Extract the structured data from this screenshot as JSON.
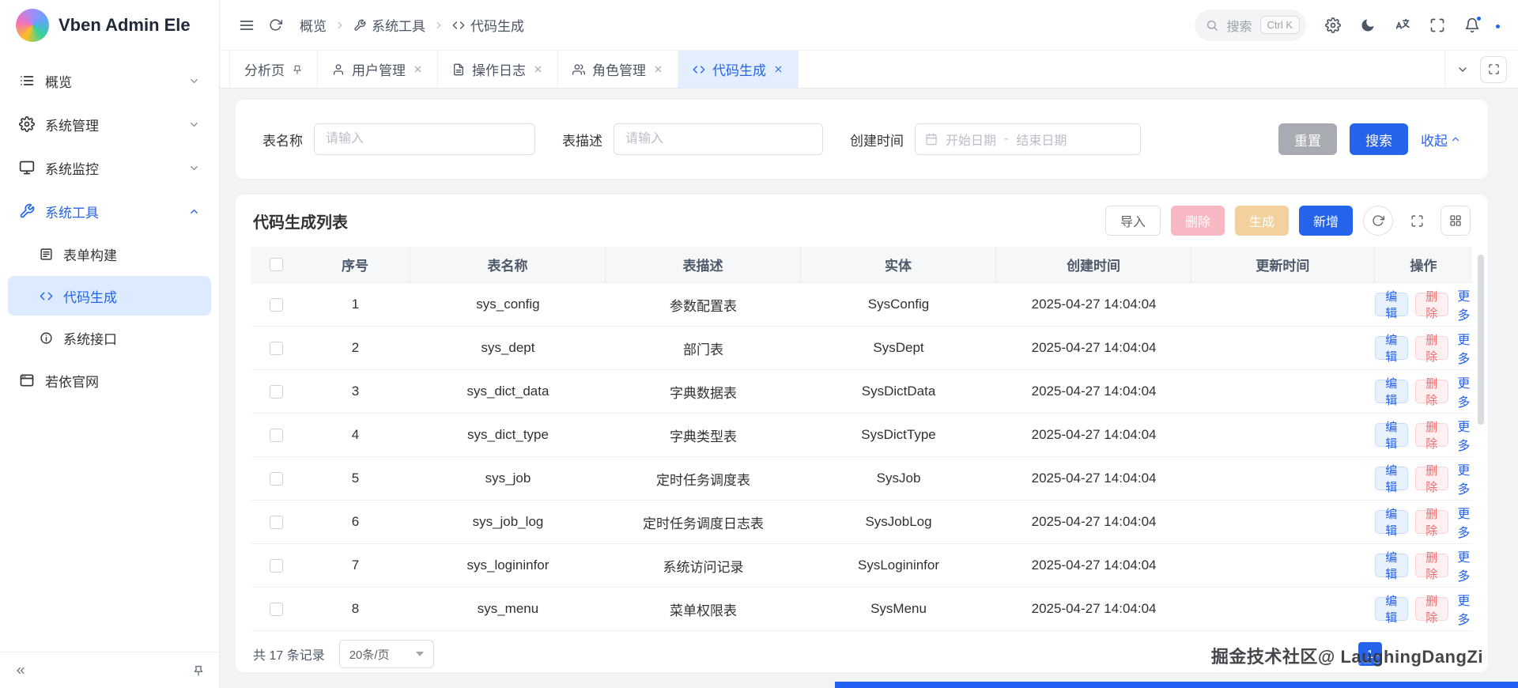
{
  "app": {
    "title": "Vben Admin Ele"
  },
  "colors": {
    "primary": "#2563eb",
    "primary_light": "#e3eeff",
    "danger": "#f56c6c"
  },
  "topbar": {
    "breadcrumb": [
      {
        "label": "概览"
      },
      {
        "label": "系统工具"
      },
      {
        "label": "代码生成"
      }
    ],
    "search_placeholder": "搜索",
    "search_shortcut": "Ctrl K"
  },
  "sidebar": {
    "items": [
      {
        "label": "概览"
      },
      {
        "label": "系统管理"
      },
      {
        "label": "系统监控"
      },
      {
        "label": "系统工具"
      },
      {
        "label": "表单构建"
      },
      {
        "label": "代码生成"
      },
      {
        "label": "系统接口"
      },
      {
        "label": "若依官网"
      }
    ]
  },
  "tabs": [
    {
      "label": "分析页"
    },
    {
      "label": "用户管理"
    },
    {
      "label": "操作日志"
    },
    {
      "label": "角色管理"
    },
    {
      "label": "代码生成"
    }
  ],
  "filter": {
    "table_name_label": "表名称",
    "table_name_placeholder": "请输入",
    "table_desc_label": "表描述",
    "table_desc_placeholder": "请输入",
    "created_label": "创建时间",
    "date_start_placeholder": "开始日期",
    "date_separator": "-",
    "date_end_placeholder": "结束日期",
    "reset_label": "重置",
    "search_label": "搜索",
    "collapse_label": "收起"
  },
  "table_card": {
    "title": "代码生成列表",
    "import_label": "导入",
    "delete_label": "删除",
    "generate_label": "生成",
    "add_label": "新增",
    "columns": [
      "序号",
      "表名称",
      "表描述",
      "实体",
      "创建时间",
      "更新时间",
      "操作"
    ],
    "row_actions": {
      "edit": "编辑",
      "delete": "删除",
      "more": "更多"
    },
    "rows": [
      {
        "index": "1",
        "table_name": "sys_config",
        "description": "参数配置表",
        "entity": "SysConfig",
        "created_at": "2025-04-27 14:04:04",
        "updated_at": ""
      },
      {
        "index": "2",
        "table_name": "sys_dept",
        "description": "部门表",
        "entity": "SysDept",
        "created_at": "2025-04-27 14:04:04",
        "updated_at": ""
      },
      {
        "index": "3",
        "table_name": "sys_dict_data",
        "description": "字典数据表",
        "entity": "SysDictData",
        "created_at": "2025-04-27 14:04:04",
        "updated_at": ""
      },
      {
        "index": "4",
        "table_name": "sys_dict_type",
        "description": "字典类型表",
        "entity": "SysDictType",
        "created_at": "2025-04-27 14:04:04",
        "updated_at": ""
      },
      {
        "index": "5",
        "table_name": "sys_job",
        "description": "定时任务调度表",
        "entity": "SysJob",
        "created_at": "2025-04-27 14:04:04",
        "updated_at": ""
      },
      {
        "index": "6",
        "table_name": "sys_job_log",
        "description": "定时任务调度日志表",
        "entity": "SysJobLog",
        "created_at": "2025-04-27 14:04:04",
        "updated_at": ""
      },
      {
        "index": "7",
        "table_name": "sys_logininfor",
        "description": "系统访问记录",
        "entity": "SysLogininfor",
        "created_at": "2025-04-27 14:04:04",
        "updated_at": ""
      },
      {
        "index": "8",
        "table_name": "sys_menu",
        "description": "菜单权限表",
        "entity": "SysMenu",
        "created_at": "2025-04-27 14:04:04",
        "updated_at": ""
      }
    ],
    "footer": {
      "total": "共 17 条记录",
      "page_size": "20条/页",
      "current_page": "1"
    }
  },
  "watermark": "掘金技术社区@ LaughingDangZi"
}
